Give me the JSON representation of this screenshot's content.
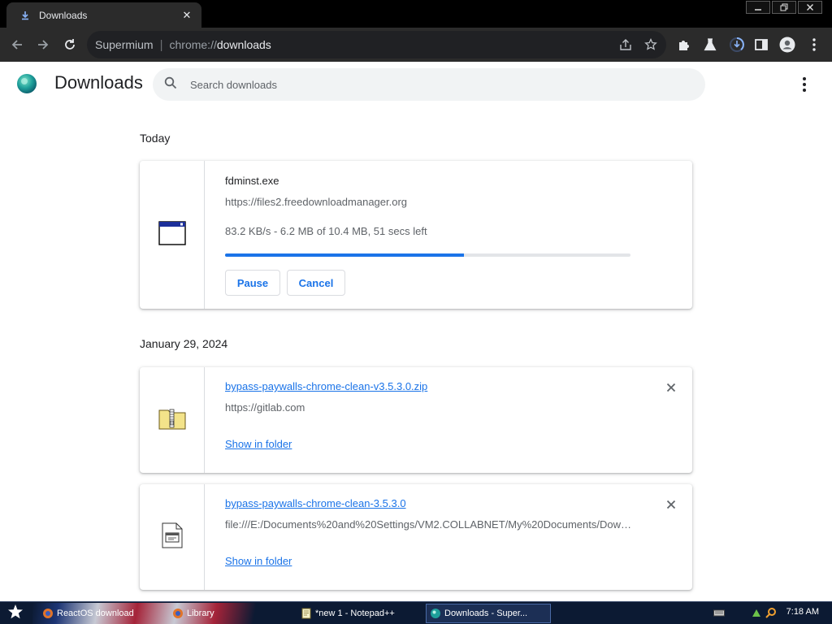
{
  "browser": {
    "tab_title": "Downloads",
    "address": {
      "site_name": "Supermium",
      "scheme": "chrome://",
      "path": "downloads"
    }
  },
  "page": {
    "title": "Downloads",
    "search_placeholder": "Search downloads"
  },
  "sections": {
    "today_label": "Today",
    "older_label": "January 29, 2024"
  },
  "active_download": {
    "file_name": "fdminst.exe",
    "url": "https://files2.freedownloadmanager.org",
    "status": "83.2 KB/s - 6.2 MB of 10.4 MB, 51 secs left",
    "progress_fraction": 0.59,
    "pause_label": "Pause",
    "cancel_label": "Cancel"
  },
  "completed_downloads": [
    {
      "file_name": "bypass-paywalls-chrome-clean-v3.5.3.0.zip",
      "url": "https://gitlab.com",
      "show_in_folder_label": "Show in folder",
      "icon": "zip-folder-icon"
    },
    {
      "file_name": "bypass-paywalls-chrome-clean-3.5.3.0",
      "url": "file:///E:/Documents%20and%20Settings/VM2.COLLABNET/My%20Documents/Down...",
      "show_in_folder_label": "Show in folder",
      "icon": "extension-file-icon"
    }
  ],
  "taskbar": {
    "items": [
      {
        "label": "ReactOS download"
      },
      {
        "label": "Library"
      },
      {
        "label": "*new 1 - Notepad++"
      },
      {
        "label": "Downloads - Super..."
      }
    ],
    "clock": "7:18 AM"
  },
  "colors": {
    "accent": "#1a73e8",
    "toolbar_bg": "#2b2b2b",
    "titlebar_bg": "#000000",
    "taskbar_bg": "#0c1a33"
  }
}
